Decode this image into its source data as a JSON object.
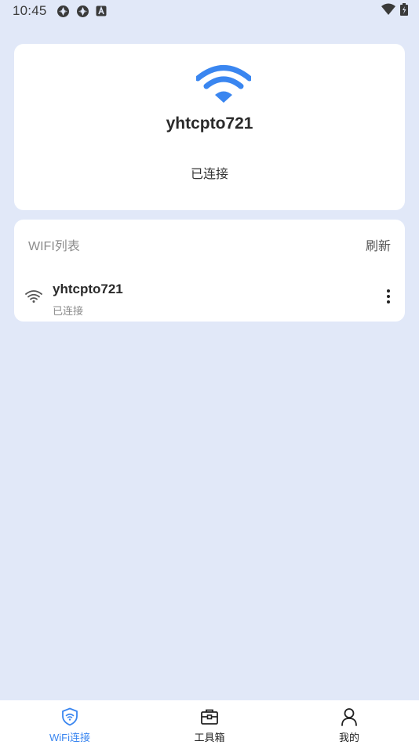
{
  "status_bar": {
    "time": "10:45",
    "icons": [
      "aperture-icon",
      "aperture-icon",
      "a-square-icon"
    ],
    "right_icons": [
      "wifi-signal-icon",
      "battery-icon"
    ]
  },
  "current_connection": {
    "icon": "wifi-icon",
    "accent_color": "#3a86f0",
    "ssid": "yhtcpto721",
    "status": "已连接"
  },
  "wifi_list": {
    "title": "WIFI列表",
    "refresh_label": "刷新",
    "items": [
      {
        "ssid": "yhtcpto721",
        "status": "已连接",
        "icon": "wifi-icon",
        "menu_icon": "more-vertical-icon"
      }
    ]
  },
  "tab_bar": {
    "active_color": "#3a86f0",
    "tabs": [
      {
        "label": "WiFi连接",
        "icon": "shield-wifi-icon",
        "active": true
      },
      {
        "label": "工具箱",
        "icon": "toolbox-icon",
        "active": false
      },
      {
        "label": "我的",
        "icon": "user-icon",
        "active": false
      }
    ]
  }
}
